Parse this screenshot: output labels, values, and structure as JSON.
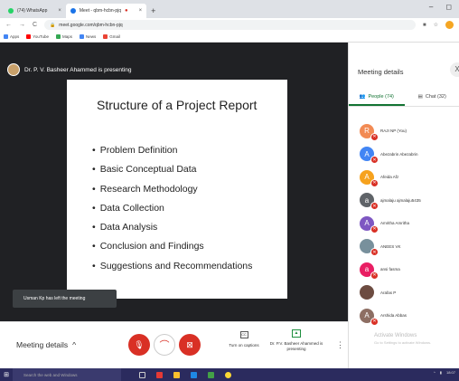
{
  "browser": {
    "tabs": [
      {
        "label": "(74) WhatsApp",
        "color": "#25d366"
      },
      {
        "label": "Meet - qbm-hcbn-pjq",
        "color": "#1a73e8",
        "recording": "●"
      }
    ],
    "new_tab": "+",
    "window_controls": {
      "minimize": "–",
      "restore": "◻"
    },
    "url": "meet.google.com/qbm-hcbn-pjq",
    "nav": {
      "back": "←",
      "forward": "→",
      "reload": "C"
    },
    "bookmarks": [
      {
        "label": "Apps",
        "color": "#4285f4"
      },
      {
        "label": "YouTube",
        "color": "#ff0000"
      },
      {
        "label": "Maps",
        "color": "#34a853"
      },
      {
        "label": "News",
        "color": "#4285f4"
      },
      {
        "label": "Gmail",
        "color": "#ea4335"
      }
    ]
  },
  "stage": {
    "presenter_label": "Dr. P. V. Basheer Ahammed is presenting",
    "slide": {
      "title": "Structure of a Project Report",
      "bullets": [
        "Problem Definition",
        "Basic Conceptual Data",
        "Research Methodology",
        "Data Collection",
        "Data Analysis",
        "Conclusion and Findings",
        "Suggestions and Recommendations"
      ]
    },
    "toast": "Usman Kp has left the meeting"
  },
  "controls": {
    "meeting_details": "Meeting details",
    "mic_icon": "mic-off",
    "hangup_icon": "call-end",
    "camera_icon": "camera-off",
    "captions_label": "Turn on captions",
    "captions_icon": "CC",
    "present_label": "Dr. P.V. Basheer Ahammed is presenting",
    "more": "⋮"
  },
  "panel": {
    "title": "Meeting details",
    "close": "X",
    "tab_people": "People (74)",
    "tab_chat": "Chat (32)",
    "people": [
      {
        "initial": "R",
        "name": "RAJI NP (You)",
        "color": "#f28b54"
      },
      {
        "initial": "A",
        "name": "Abezabrin Abezabrin",
        "color": "#4285f4"
      },
      {
        "initial": "A",
        "name": "Afeida Afz",
        "color": "#f6a21e"
      },
      {
        "initial": "a",
        "name": "ajmalaju ajmalaju5435",
        "color": "#5f6368"
      },
      {
        "initial": "A",
        "name": "Amritha Amritha",
        "color": "#7e57c2"
      },
      {
        "initial": "",
        "name": "ANEES VK",
        "color": "#78909c"
      },
      {
        "initial": "a",
        "name": "ansi fasma",
        "color": "#e91e63"
      },
      {
        "initial": "",
        "name": "Arafas P",
        "color": "#6d4c41"
      },
      {
        "initial": "A",
        "name": "Arshida Abbas",
        "color": "#8d6e63"
      }
    ],
    "watermark_line1": "Activate Windows",
    "watermark_line2": "Go to Settings to activate Windows."
  },
  "taskbar": {
    "search": "Search the web and Windows",
    "clock": "18:07"
  }
}
